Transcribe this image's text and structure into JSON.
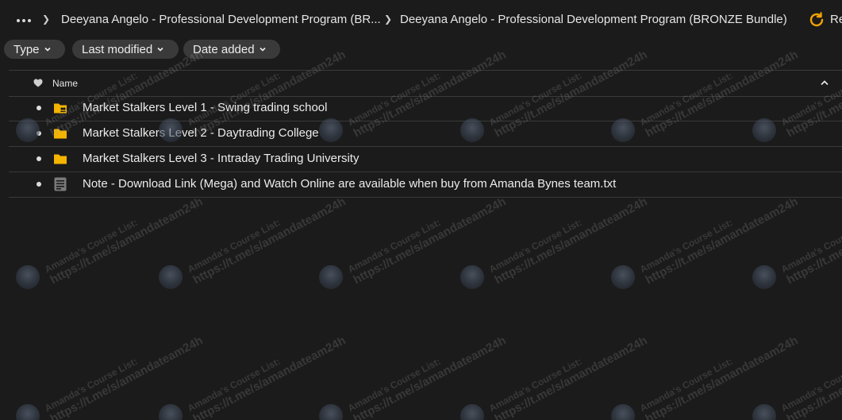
{
  "breadcrumb": {
    "more_icon": "more-horizontal-icon",
    "items": [
      "Deeyana Angelo - Professional Development Program (BR...",
      "Deeyana Angelo - Professional Development Program (BRONZE Bundle)"
    ],
    "right_action_label": "Re"
  },
  "filters": [
    {
      "label": "Type"
    },
    {
      "label": "Last modified"
    },
    {
      "label": "Date added"
    }
  ],
  "table": {
    "header": {
      "name": "Name"
    },
    "rows": [
      {
        "icon": "shared-folder-icon",
        "name": "Market Stalkers Level 1 - Swing trading school"
      },
      {
        "icon": "folder-icon",
        "name": "Market Stalkers Level 2 - Daytrading College"
      },
      {
        "icon": "folder-icon",
        "name": "Market Stalkers Level 3 - Intraday Trading University"
      },
      {
        "icon": "text-file-icon",
        "name": "Note - Download Link (Mega) and Watch Online are available when buy from Amanda Bynes team.txt"
      }
    ]
  },
  "watermark": {
    "line1": "Amanda's Course List:",
    "line2": "https://t.me/s/amandateam24h"
  },
  "colors": {
    "background": "#1b1b1b",
    "chip": "#3a3a3a",
    "folder": "#f4b400",
    "refresh": "#f4a300"
  }
}
